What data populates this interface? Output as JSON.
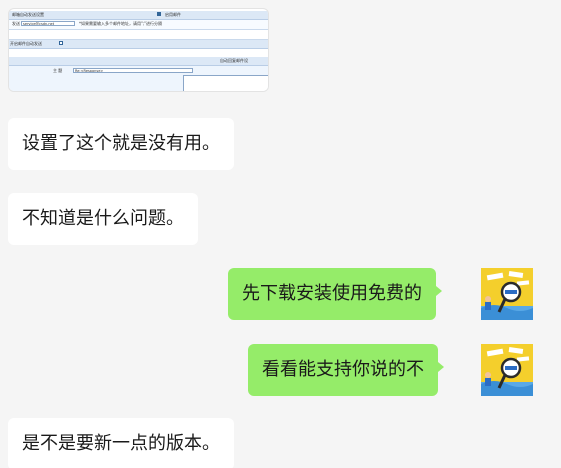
{
  "messages": [
    {
      "side": "left",
      "type": "image",
      "screenshot": {
        "row1_label": "邮箱自动发送设置",
        "row1_right_label": "启用邮件",
        "row2_label": "发送",
        "row2_input_value": "service@csdn.net",
        "row2_note": "*如果需要输入多个邮件地址，请用\";\"进行分隔",
        "row3_label": "开启邮件自动发送",
        "row4_right_label": "自动回复邮件设",
        "row5_label": "主 题",
        "row5_input_value": "Re:<Response>"
      }
    },
    {
      "side": "left",
      "type": "text",
      "text": "设置了这个就是没有用。"
    },
    {
      "side": "left",
      "type": "text",
      "text": "不知道是什么问题。"
    },
    {
      "side": "right",
      "type": "text",
      "text": "先下载安装使用免费的",
      "avatar": "profile-avatar"
    },
    {
      "side": "right",
      "type": "text",
      "text": "看看能支持你说的不",
      "avatar": "profile-avatar"
    },
    {
      "side": "left",
      "type": "text",
      "text": "是不是要新一点的版本。"
    }
  ],
  "colors": {
    "background": "#f5f5f5",
    "incoming_bubble": "#ffffff",
    "outgoing_bubble": "#95ec69",
    "avatar_bg": "#f4cf2c"
  }
}
